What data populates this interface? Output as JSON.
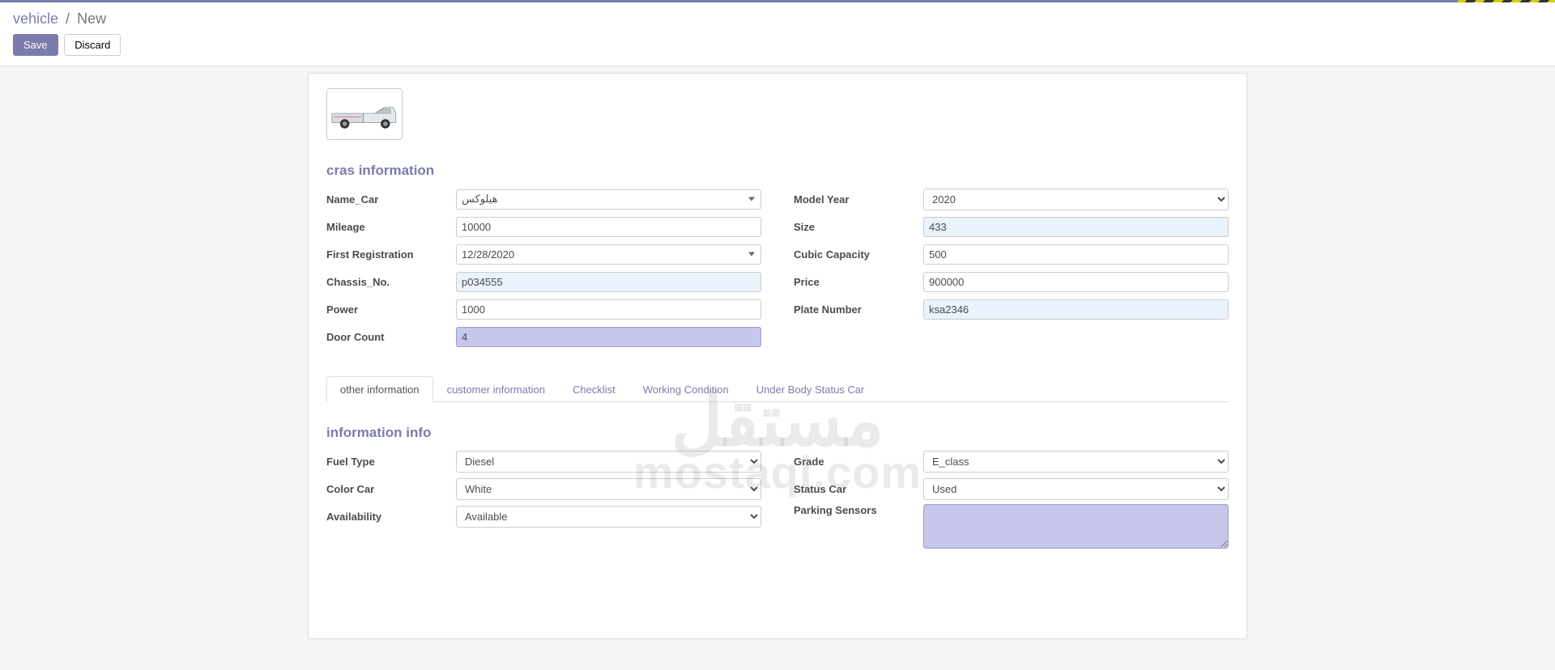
{
  "breadcrumb": {
    "parent": "vehicle",
    "current": "New"
  },
  "buttons": {
    "save": "Save",
    "discard": "Discard"
  },
  "sections": {
    "cras_title": "cras information",
    "info_title": "information info"
  },
  "labels": {
    "name_car": "Name_Car",
    "mileage": "Mileage",
    "first_registration": "First Registration",
    "chassis_no": "Chassis_No.",
    "power": "Power",
    "door_count": "Door Count",
    "model_year": "Model Year",
    "size": "Size",
    "cubic_capacity": "Cubic Capacity",
    "price": "Price",
    "plate_number": "Plate Number",
    "fuel_type": "Fuel Type",
    "color_car": "Color Car",
    "availability": "Availability",
    "grade": "Grade",
    "status_car": "Status Car",
    "parking_sensors": "Parking Sensors"
  },
  "values": {
    "name_car": "هيلوكس",
    "mileage": "10000",
    "first_registration": "12/28/2020",
    "chassis_no": "p034555",
    "power": "1000",
    "door_count": "4",
    "model_year": "2020",
    "size": "433",
    "cubic_capacity": "500",
    "price": "900000",
    "plate_number": "ksa2346",
    "fuel_type": "Diesel",
    "color_car": "White",
    "availability": "Available",
    "grade": "E_class",
    "status_car": "Used",
    "parking_sensors": ""
  },
  "tabs": [
    "other information",
    "customer information",
    "Checklist",
    "Working Condition",
    "Under Body Status Car"
  ],
  "watermark": {
    "ar": "مستقل",
    "en": "mostaql.com"
  }
}
